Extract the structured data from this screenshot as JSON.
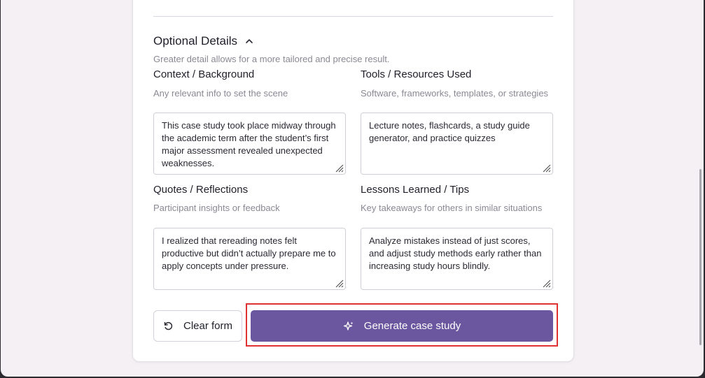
{
  "optional_details": {
    "title": "Optional Details",
    "subtitle": "Greater detail allows for a more tailored and precise result."
  },
  "fields": {
    "context": {
      "label": "Context / Background",
      "help": "Any relevant info to set the scene",
      "value": "This case study took place midway through the academic term after the student’s first major assessment revealed unexpected weaknesses."
    },
    "tools": {
      "label": "Tools / Resources Used",
      "help": "Software, frameworks, templates, or strategies",
      "value": "Lecture notes, flashcards, a study guide generator, and practice quizzes"
    },
    "quotes": {
      "label": "Quotes / Reflections",
      "help": "Participant insights or feedback",
      "value": "I realized that rereading notes felt productive but didn’t actually prepare me to apply concepts under pressure."
    },
    "lessons": {
      "label": "Lessons Learned / Tips",
      "help": "Key takeaways for others in similar situations",
      "value": "Analyze mistakes instead of just scores, and adjust study methods early rather than increasing study hours blindly."
    }
  },
  "actions": {
    "clear_label": "Clear form",
    "generate_label": "Generate case study"
  },
  "icons": {
    "collapse": "chevron-up-icon",
    "clear": "rotate-ccw-icon",
    "generate": "sparkles-icon"
  },
  "colors": {
    "primary": "#6b56a0",
    "highlight": "#e03232"
  }
}
